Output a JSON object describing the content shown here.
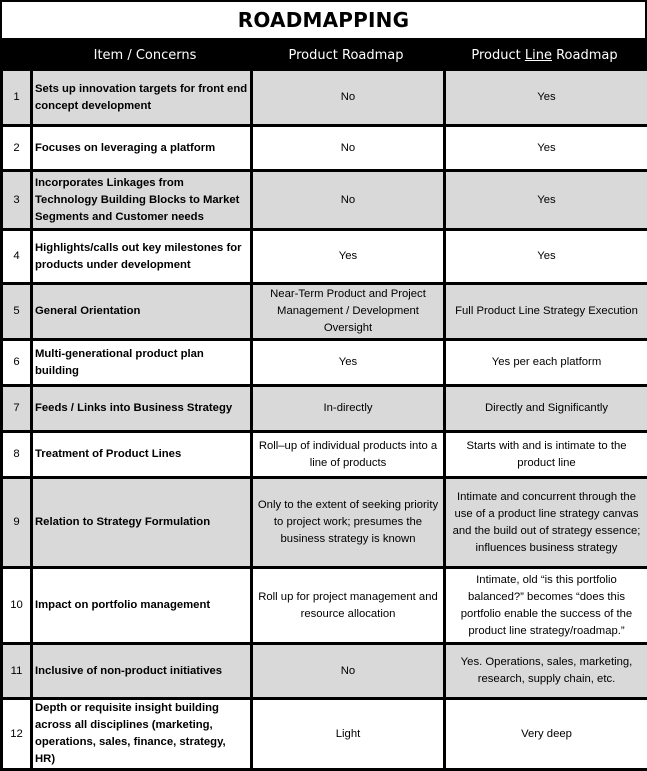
{
  "title": "ROADMAPPING",
  "header": {
    "col_item": "Item / Concerns",
    "col_product": "Product Roadmap",
    "col_line_prefix": "Product ",
    "col_line_underlined": "Line",
    "col_line_suffix": " Roadmap"
  },
  "rows": [
    {
      "num": "1",
      "concern": "Sets up innovation targets for front end concept development",
      "product": "No",
      "line": "Yes"
    },
    {
      "num": "2",
      "concern": "Focuses on leveraging a platform",
      "product": "No",
      "line": "Yes"
    },
    {
      "num": "3",
      "concern": "Incorporates Linkages from Technology Building Blocks to Market Segments and Customer needs",
      "product": "No",
      "line": "Yes"
    },
    {
      "num": "4",
      "concern": "Highlights/calls out key milestones for products under development",
      "product": "Yes",
      "line": "Yes"
    },
    {
      "num": "5",
      "concern": "General Orientation",
      "product": "Near-Term Product and Project Management / Development Oversight",
      "line": "Full Product Line Strategy Execution"
    },
    {
      "num": "6",
      "concern": "Multi-generational product plan building",
      "product": "Yes",
      "line": "Yes per each platform"
    },
    {
      "num": "7",
      "concern": "Feeds / Links into  Business Strategy",
      "product": "In-directly",
      "line": "Directly and Significantly"
    },
    {
      "num": "8",
      "concern": "Treatment of Product Lines",
      "product": "Roll–up of individual products into a line of products",
      "line": "Starts with and is intimate to the product line"
    },
    {
      "num": "9",
      "concern": "Relation to Strategy Formulation",
      "product": "Only to the extent of seeking priority to project work; presumes the business strategy is known",
      "line": "Intimate and concurrent through the use of a product line strategy canvas and the build out of strategy essence; influences business strategy"
    },
    {
      "num": "10",
      "concern": "Impact on portfolio management",
      "product": "Roll up for project management and resource allocation",
      "line": "Intimate, old “is this portfolio balanced?” becomes “does this portfolio enable the success of the product line strategy/roadmap.”"
    },
    {
      "num": "11",
      "concern": "Inclusive of non-product initiatives",
      "product": "No",
      "line": "Yes.  Operations, sales, marketing, research, supply chain, etc."
    },
    {
      "num": "12",
      "concern": "Depth or requisite insight building across all disciplines (marketing, operations, sales, finance, strategy, HR)",
      "product": "Light",
      "line": "Very deep"
    }
  ]
}
